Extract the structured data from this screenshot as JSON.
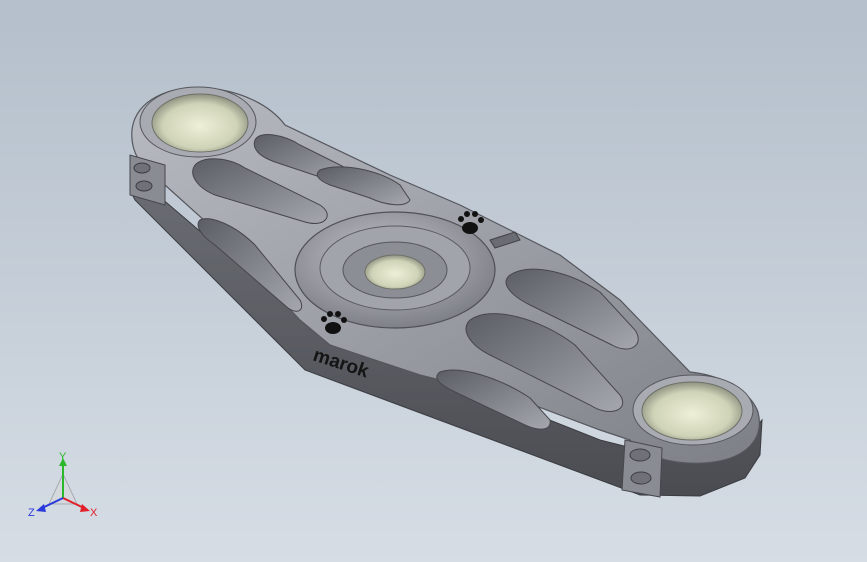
{
  "viewport": {
    "background_top": "#b4bfcb",
    "background_bottom": "#d6dde5"
  },
  "model": {
    "engraving_text": "marok",
    "engraving_logo": "paw-print-logo",
    "material_color": "#8e9097"
  },
  "triad": {
    "x_label": "X",
    "y_label": "Y",
    "z_label": "Z",
    "x_color": "#e0202a",
    "y_color": "#2ab82a",
    "z_color": "#2a3adc"
  }
}
